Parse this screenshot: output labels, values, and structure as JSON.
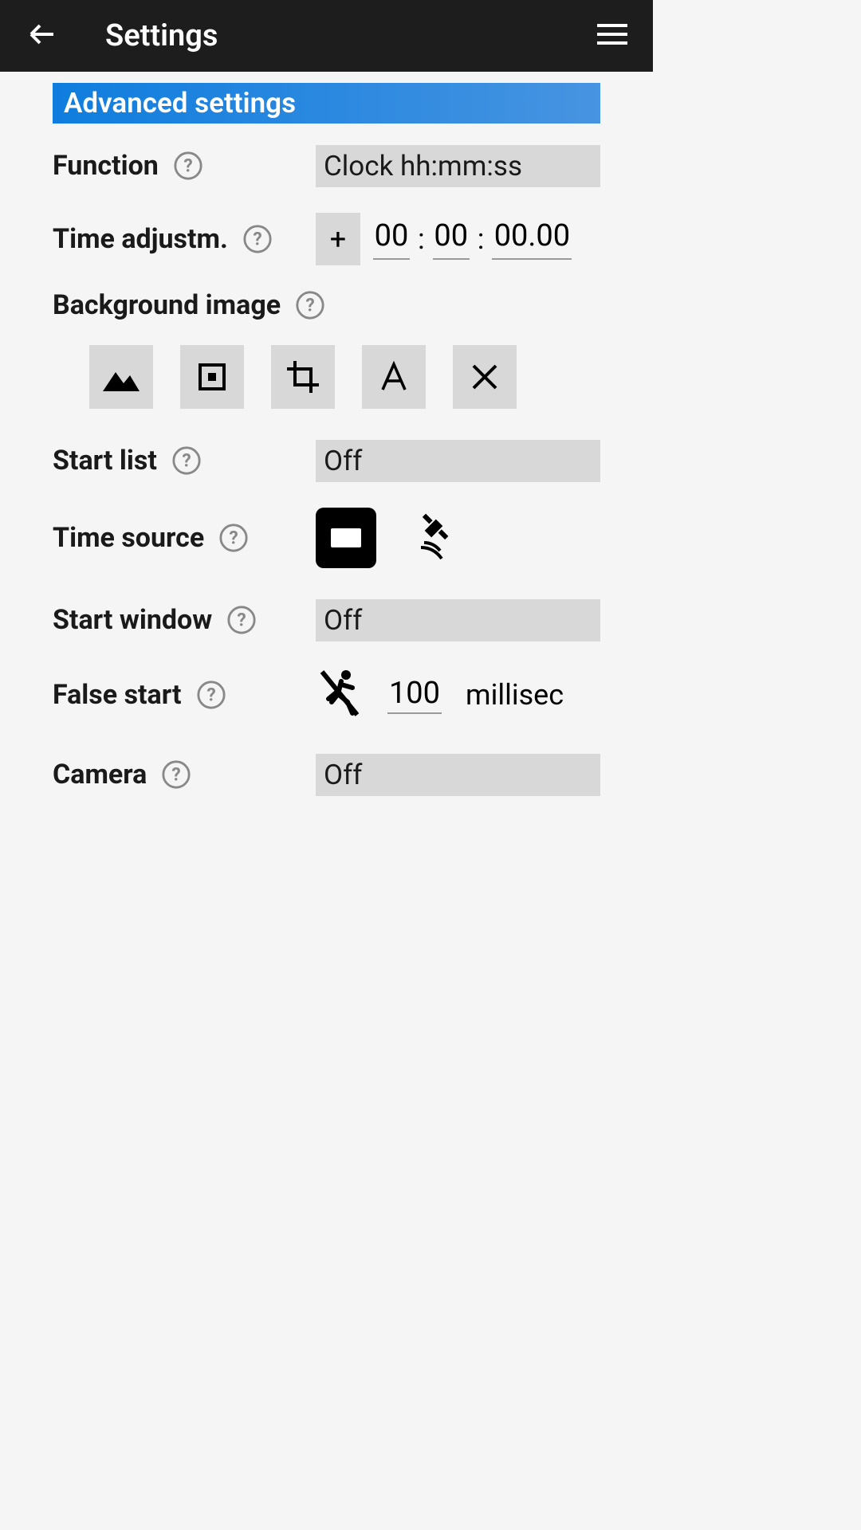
{
  "header": {
    "title": "Settings"
  },
  "section": {
    "title": "Advanced settings"
  },
  "function": {
    "label": "Function",
    "value": "Clock hh:mm:ss"
  },
  "timeAdjust": {
    "label": "Time adjustm.",
    "sign": "+",
    "hours": "00",
    "minutes": "00",
    "seconds": "00.00"
  },
  "backgroundImage": {
    "label": "Background image"
  },
  "startList": {
    "label": "Start list",
    "value": "Off"
  },
  "timeSource": {
    "label": "Time source"
  },
  "startWindow": {
    "label": "Start window",
    "value": "Off"
  },
  "falseStart": {
    "label": "False start",
    "value": "100",
    "unit": "millisec"
  },
  "camera": {
    "label": "Camera",
    "value": "Off"
  }
}
